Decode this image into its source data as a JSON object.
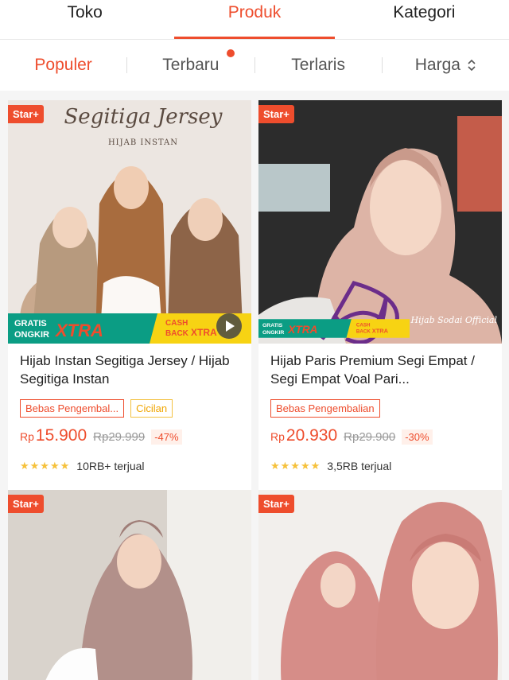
{
  "top_tabs": [
    {
      "label": "Toko"
    },
    {
      "label": "Produk"
    },
    {
      "label": "Kategori"
    }
  ],
  "sort": {
    "populer": "Populer",
    "terbaru": "Terbaru",
    "terlaris": "Terlaris",
    "harga": "Harga"
  },
  "products": [
    {
      "badge": "Star+",
      "image_title": "Segitiga Jersey",
      "image_subtitle": "HIJAB INSTAN",
      "promo": {
        "gratis": "GRATIS",
        "ongkir": "ONGKIR",
        "xtra": "XTRA",
        "cash": "CASH",
        "back": "BACK",
        "xtra2": "XTRA"
      },
      "title": "Hijab Instan Segitiga Jersey / Hijab Segitiga Instan",
      "tag1": "Bebas Pengembal...",
      "tag2": "Cicilan",
      "currency": "Rp",
      "price": "15.900",
      "old_price": "Rp29.999",
      "discount": "-47%",
      "stars": "★★★★★",
      "sold": "10RB+ terjual"
    },
    {
      "badge": "Star+",
      "watermark": "Hijab Sodai Official",
      "promo": {
        "gratis": "GRATIS",
        "ongkir": "ONGKIR",
        "xtra": "XTRA",
        "cash": "CASH",
        "back": "BACK",
        "xtra2": "XTRA"
      },
      "title": "Hijab Paris Premium Segi Empat / Segi Empat Voal Pari...",
      "tag1": "Bebas Pengembalian",
      "currency": "Rp",
      "price": "20.930",
      "old_price": "Rp29.900",
      "discount": "-30%",
      "stars": "★★★★★",
      "sold": "3,5RB terjual"
    },
    {
      "badge": "Star+"
    },
    {
      "badge": "Star+"
    }
  ],
  "colors": {
    "accent": "#ee4d2d",
    "star": "#f6c13b"
  }
}
